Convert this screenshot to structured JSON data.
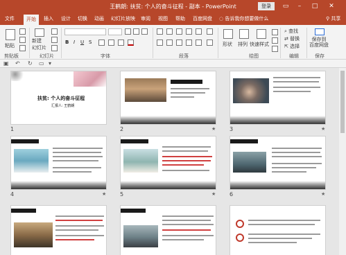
{
  "window": {
    "title": "王鹤朗: 扶贫: 个人的奋斗征程 - 副本  -  PowerPoint",
    "login_label": "登录",
    "controls": [
      "restore-icon",
      "minimize-icon",
      "maximize-icon",
      "close-icon"
    ]
  },
  "tabs": [
    "文件",
    "开始",
    "插入",
    "设计",
    "切换",
    "动画",
    "幻灯片放映",
    "审阅",
    "视图",
    "帮助",
    "百度网盘"
  ],
  "active_tab": "开始",
  "tell_me": "告诉我你想要做什么",
  "share_label": "共享",
  "ribbon": {
    "paste_label": "粘贴",
    "new_slide_label": "新建\n幻灯片",
    "shapes_label": "形状",
    "arrange_label": "排列",
    "quick_styles_label": "快速样式",
    "find_label": "查找",
    "replace_label": "替换",
    "select_label": "选择",
    "save_baidu_label": "保存到\n百度网盘",
    "groups": {
      "clipboard": "剪贴板",
      "slides": "幻灯片",
      "font": "字体",
      "paragraph": "段落",
      "drawing": "绘图",
      "editing": "编辑",
      "save": "保存"
    }
  },
  "slide1": {
    "title": "扶贫: 个人的奋斗征程",
    "presenter": "汇报人: 王鹤朗"
  },
  "slides": [
    {
      "number": "1",
      "has_star": false
    },
    {
      "number": "2",
      "has_star": true
    },
    {
      "number": "3",
      "has_star": true
    },
    {
      "number": "4",
      "has_star": true
    },
    {
      "number": "5",
      "has_star": true
    },
    {
      "number": "6",
      "has_star": true
    },
    {
      "number": "",
      "has_star": false
    },
    {
      "number": "",
      "has_star": false
    },
    {
      "number": "",
      "has_star": false
    }
  ],
  "colors": {
    "brand": "#b7472a",
    "ribbon": "#f3f3f3",
    "canvas": "#e6e6e6"
  }
}
